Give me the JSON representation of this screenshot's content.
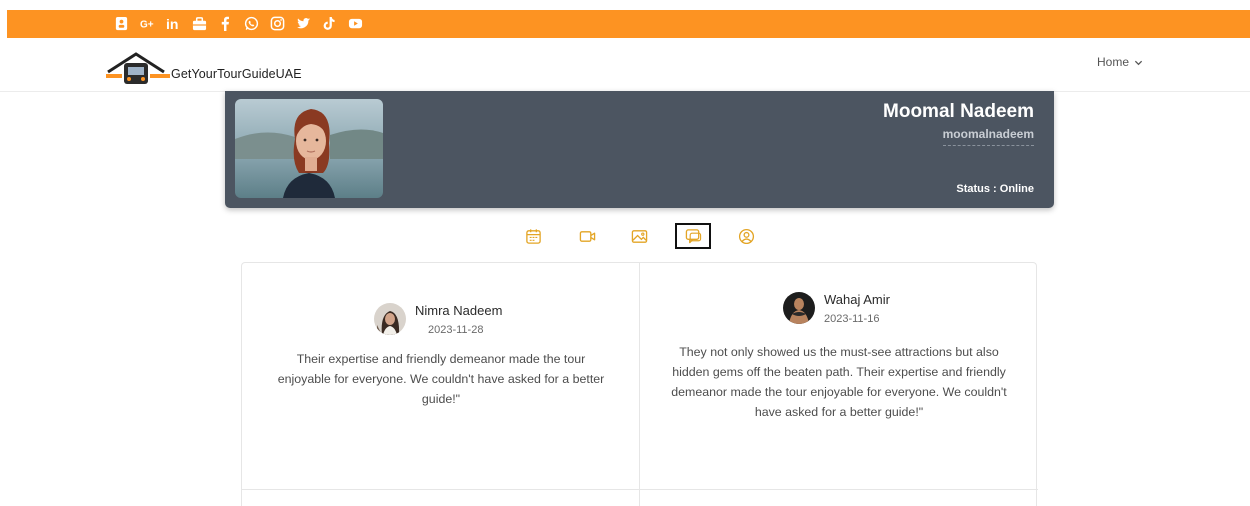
{
  "social": {
    "icons": [
      "contact-book-icon",
      "google-plus-icon",
      "linkedin-icon",
      "briefcase-icon",
      "facebook-icon",
      "whatsapp-icon",
      "instagram-icon",
      "twitter-icon",
      "tiktok-icon",
      "youtube-icon"
    ],
    "bar_color": "#fd9322"
  },
  "header": {
    "logo_text": "GetYourTourGuideUAE",
    "nav_home": "Home"
  },
  "profile": {
    "name": "Moomal Nadeem",
    "username": "moomalnadeem",
    "status": "Status : Online",
    "banner_color": "#4c5561"
  },
  "tabs": {
    "items": [
      "calendar-icon",
      "video-icon",
      "image-icon",
      "reviews-icon",
      "user-icon"
    ],
    "active": "reviews-icon",
    "accent": "#e3a526"
  },
  "reviews": [
    {
      "name": "Nimra Nadeem",
      "date": "2023-11-28",
      "text": "Their expertise and friendly demeanor made the tour enjoyable for everyone. We couldn't have asked for a better guide!\""
    },
    {
      "name": "Wahaj Amir",
      "date": "2023-11-16",
      "text": "They not only showed us the must-see attractions but also hidden gems off the beaten path. Their expertise and friendly demeanor made the tour enjoyable for everyone. We couldn't have asked for a better guide!\""
    }
  ]
}
